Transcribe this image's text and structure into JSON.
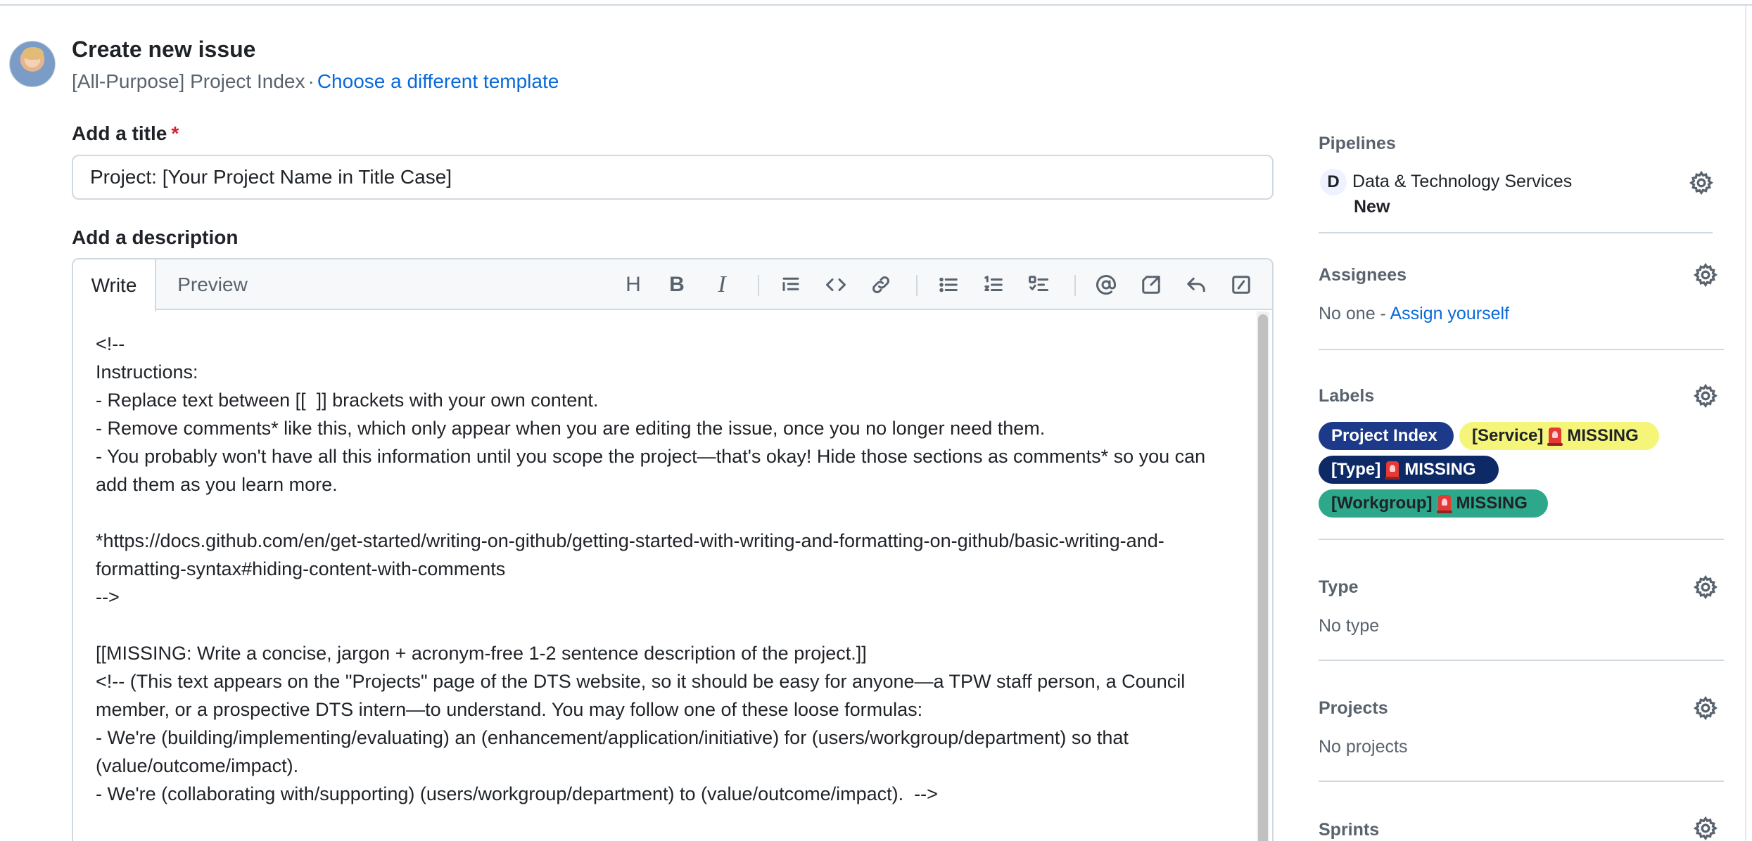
{
  "header": {
    "title": "Create new issue",
    "template_name": "[All-Purpose] Project Index",
    "separator": "·",
    "change_template_link": "Choose a different template"
  },
  "title_field": {
    "label": "Add a title",
    "required_mark": "*",
    "value": "Project: [Your Project Name in Title Case]"
  },
  "description_field": {
    "label": "Add a description",
    "tabs": {
      "write": "Write",
      "preview": "Preview"
    },
    "toolbar_icons": [
      "heading-icon",
      "bold-icon",
      "italic-icon",
      "quote-icon",
      "code-icon",
      "link-icon",
      "bulleted-list-icon",
      "numbered-list-icon",
      "task-list-icon",
      "mention-icon",
      "reference-icon",
      "reply-icon",
      "slash-command-icon"
    ],
    "toolbar_glyphs": {
      "heading": "H",
      "bold": "B",
      "italic": "I"
    },
    "body": "<!--\nInstructions:\n- Replace text between [[  ]] brackets with your own content.\n- Remove comments* like this, which only appear when you are editing the issue, once you no longer need them.\n- You probably won't have all this information until you scope the project—that's okay! Hide those sections as comments* so you can add them as you learn more.\n\n*https://docs.github.com/en/get-started/writing-on-github/getting-started-with-writing-and-formatting-on-github/basic-writing-and-formatting-syntax#hiding-content-with-comments\n-->\n\n[[MISSING: Write a concise, jargon + acronym-free 1-2 sentence description of the project.]]\n<!-- (This text appears on the \"Projects\" page of the DTS website, so it should be easy for anyone—a TPW staff person, a Council member, or a prospective DTS intern—to understand. You may follow one of these loose formulas:\n- We're (building/implementing/evaluating) an (enhancement/application/initiative) for (users/workgroup/department) so that (value/outcome/impact).\n- We're (collaborating with/supporting) (users/workgroup/department) to (value/outcome/impact).  -->"
  },
  "sidebar": {
    "pipelines": {
      "title": "Pipelines",
      "workspace_initial": "D",
      "workspace_name": "Data & Technology Services",
      "stage": "New"
    },
    "assignees": {
      "title": "Assignees",
      "none_text": "No one - ",
      "assign_link": "Assign yourself"
    },
    "labels": {
      "title": "Labels",
      "items": [
        {
          "text": "Project Index",
          "missing": "",
          "bg": "#1d3a8a",
          "fg": "#ffffff"
        },
        {
          "text": "[Service]",
          "missing": "MISSING",
          "bg": "#f5f57a",
          "fg": "#1f2328"
        },
        {
          "text": "[Type]",
          "missing": "MISSING",
          "bg": "#0e2a66",
          "fg": "#ffffff"
        },
        {
          "text": "[Workgroup]",
          "missing": "MISSING",
          "bg": "#2ea88a",
          "fg": "#1f2328"
        }
      ]
    },
    "type": {
      "title": "Type",
      "value": "No type"
    },
    "projects": {
      "title": "Projects",
      "value": "No projects"
    },
    "sprints": {
      "title": "Sprints"
    }
  },
  "colors": {
    "link": "#0969da",
    "required": "#d1242f",
    "muted_text": "#59636e",
    "border": "#d1d9e0"
  }
}
